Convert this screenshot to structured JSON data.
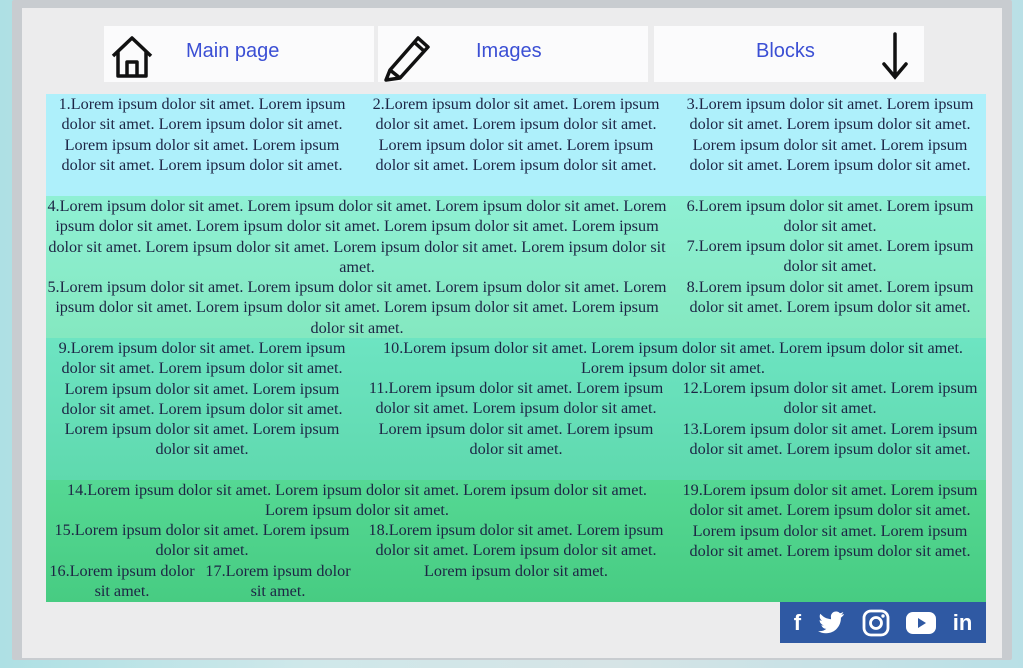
{
  "nav": {
    "home_label": "Main page",
    "images_label": "Images",
    "blocks_label": "Blocks"
  },
  "colors": {
    "band1": "#aef0fb",
    "band2": "#8fe9c8",
    "band3": "#6edcb8",
    "band4": "#4ecf86",
    "social_bg": "#2f59a3",
    "nav_text": "#3b4fd4"
  },
  "cells": {
    "c1": "1.Lorem ipsum dolor sit amet. Lorem ipsum dolor sit amet. Lorem ipsum dolor sit amet. Lorem ipsum dolor sit amet. Lorem ipsum dolor sit amet. Lorem ipsum dolor sit amet.",
    "c2": "2.Lorem ipsum dolor sit amet. Lorem ipsum dolor sit amet. Lorem ipsum dolor sit amet. Lorem ipsum dolor sit amet. Lorem ipsum dolor sit amet. Lorem ipsum dolor sit amet.",
    "c3": "3.Lorem ipsum dolor sit amet. Lorem ipsum dolor sit amet. Lorem ipsum dolor sit amet. Lorem ipsum dolor sit amet. Lorem ipsum dolor sit amet. Lorem ipsum dolor sit amet.",
    "c4": "4.Lorem ipsum dolor sit amet. Lorem ipsum dolor sit amet. Lorem ipsum dolor sit amet. Lorem ipsum dolor sit amet. Lorem ipsum dolor sit amet. Lorem ipsum dolor sit amet. Lorem ipsum dolor sit amet. Lorem ipsum dolor sit amet. Lorem ipsum dolor sit amet. Lorem ipsum dolor sit amet.",
    "c5": "5.Lorem ipsum dolor sit amet. Lorem ipsum dolor sit amet. Lorem ipsum dolor sit amet. Lorem ipsum dolor sit amet. Lorem ipsum dolor sit amet. Lorem ipsum dolor sit amet. Lorem ipsum dolor sit amet.",
    "c6": "6.Lorem ipsum dolor sit amet. Lorem ipsum dolor sit amet.",
    "c7": "7.Lorem ipsum dolor sit amet. Lorem ipsum dolor sit amet.",
    "c8": "8.Lorem ipsum dolor sit amet. Lorem ipsum dolor sit amet. Lorem ipsum dolor sit amet.",
    "c9": "9.Lorem ipsum dolor sit amet. Lorem ipsum dolor sit amet. Lorem ipsum dolor sit amet. Lorem ipsum dolor sit amet. Lorem ipsum dolor sit amet. Lorem ipsum dolor sit amet. Lorem ipsum dolor sit amet. Lorem ipsum dolor sit amet.",
    "c10": "10.Lorem ipsum dolor sit amet. Lorem ipsum dolor sit amet. Lorem ipsum dolor sit amet. Lorem ipsum dolor sit amet.",
    "c11": "11.Lorem ipsum dolor sit amet. Lorem ipsum dolor sit amet. Lorem ipsum dolor sit amet. Lorem ipsum dolor sit amet. Lorem ipsum dolor sit amet.",
    "c12": "12.Lorem ipsum dolor sit amet. Lorem ipsum dolor sit amet.",
    "c13": "13.Lorem ipsum dolor sit amet. Lorem ipsum dolor sit amet. Lorem ipsum dolor sit amet.",
    "c14": "14.Lorem ipsum dolor sit amet. Lorem ipsum dolor sit amet. Lorem ipsum dolor sit amet. Lorem ipsum dolor sit amet.",
    "c15": "15.Lorem ipsum dolor sit amet. Lorem ipsum dolor sit amet.",
    "c16": "16.Lorem ipsum dolor sit amet.",
    "c17": "17.Lorem ipsum dolor sit amet.",
    "c18": "18.Lorem ipsum dolor sit amet. Lorem ipsum dolor sit amet. Lorem ipsum dolor sit amet. Lorem ipsum dolor sit amet.",
    "c19": "19.Lorem ipsum dolor sit amet. Lorem ipsum dolor sit amet. Lorem ipsum dolor sit amet. Lorem ipsum dolor sit amet. Lorem ipsum dolor sit amet. Lorem ipsum dolor sit amet."
  },
  "social": {
    "facebook": "f",
    "linkedin": "in",
    "icons": [
      "facebook-icon",
      "twitter-icon",
      "instagram-icon",
      "youtube-icon",
      "linkedin-icon"
    ]
  }
}
